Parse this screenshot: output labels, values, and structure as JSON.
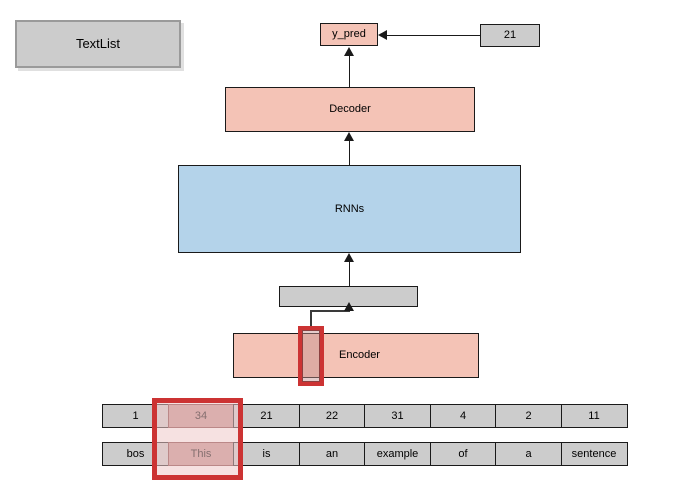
{
  "diagram": {
    "title": "TextList",
    "nodes": {
      "textlist": {
        "label": "TextList",
        "color": "#cccccc"
      },
      "y_pred": {
        "label": "y_pred",
        "color": "#f4c3b6"
      },
      "target": {
        "label": "21",
        "color": "#cccccc"
      },
      "decoder": {
        "label": "Decoder",
        "color": "#f4c3b6"
      },
      "rnns": {
        "label": "RNNs",
        "color": "#b4d3ea"
      },
      "hidden_bar": {
        "label": "",
        "color": "#cccccc"
      },
      "encoder": {
        "label": "Encoder",
        "color": "#f4c3b6"
      }
    },
    "highlight_color": "#cc3333",
    "table": {
      "rows": [
        {
          "name": "token-ids",
          "cells": [
            "1",
            "34",
            "21",
            "22",
            "31",
            "4",
            "2",
            "11"
          ],
          "highlight_index": 1
        },
        {
          "name": "tokens",
          "cells": [
            "bos",
            "This",
            "is",
            "an",
            "example",
            "of",
            "a",
            "sentence"
          ],
          "highlight_index": 1
        }
      ]
    }
  }
}
